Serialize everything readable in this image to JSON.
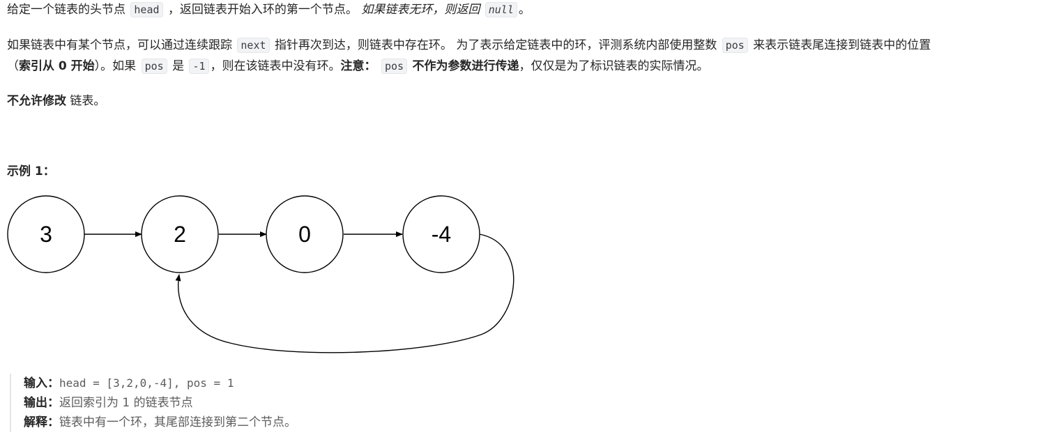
{
  "p1": {
    "a": "给定一个链表的头节点",
    "code_head": "head",
    "b": "，返回链表开始入环的第一个节点。",
    "c": "如果链表无环，则返回",
    "code_null": "null",
    "d": "。"
  },
  "p2": {
    "a": "如果链表中有某个节点，可以通过连续跟踪",
    "code_next": "next",
    "b": "指针再次到达，则链表中存在环。 为了表示给定链表中的环，评测系统内部使用整数",
    "code_pos": "pos",
    "c": "来表示链表尾连接到链表中的位置"
  },
  "p2b": {
    "a": "（",
    "bold_index": "索引从 0 开始",
    "b": "）。如果",
    "code_pos": "pos",
    "c": "是",
    "code_neg1": "-1",
    "d": "，则在该链表中没有环。",
    "bold_note": "注意：",
    "code_pos2": "pos",
    "bold_not": "不作为参数进行传递",
    "e": "，仅仅是为了标识链表的实际情况。"
  },
  "p3": {
    "bold": "不允许修改",
    "rest": " 链表。"
  },
  "example": {
    "title": "示例 1：",
    "nodes": [
      "3",
      "2",
      "0",
      "-4"
    ],
    "input_label": "输入：",
    "input_value": "head = [3,2,0,-4], pos = 1",
    "output_label": "输出：",
    "output_value": "返回索引为 1 的链表节点",
    "explain_label": "解释：",
    "explain_value": "链表中有一个环，其尾部连接到第二个节点。"
  }
}
